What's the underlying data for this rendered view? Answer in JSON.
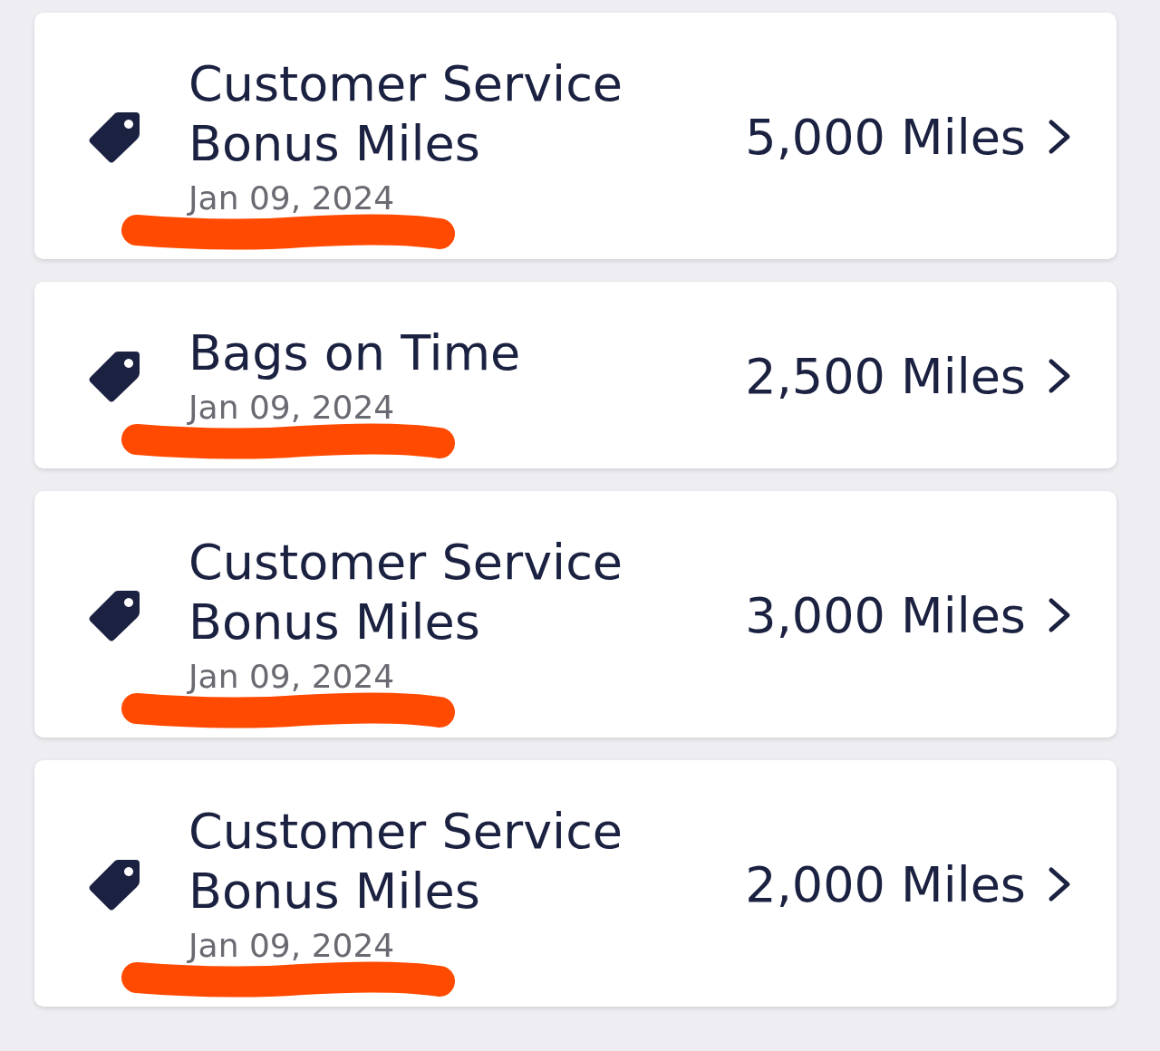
{
  "transactions": [
    {
      "title": "Customer Service Bonus Miles",
      "date": "Jan 09, 2024",
      "amount": "5,000 Miles",
      "underlined": true
    },
    {
      "title": "Bags on Time",
      "date": "Jan 09, 2024",
      "amount": "2,500 Miles",
      "underlined": true
    },
    {
      "title": "Customer Service Bonus Miles",
      "date": "Jan 09, 2024",
      "amount": "3,000 Miles",
      "underlined": true
    },
    {
      "title": "Customer Service Bonus Miles",
      "date": "Jan 09, 2024",
      "amount": "2,000 Miles",
      "underlined": true
    }
  ]
}
